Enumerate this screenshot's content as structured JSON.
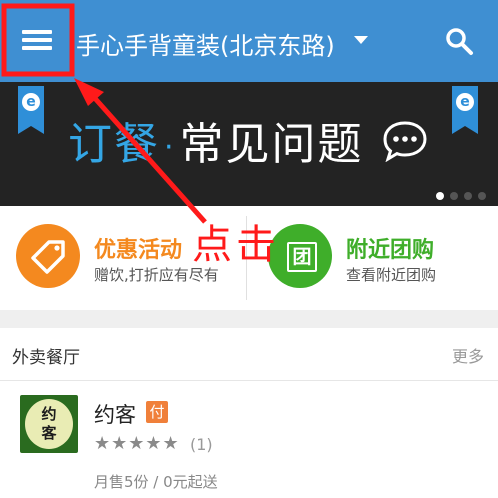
{
  "header": {
    "title": "手心手背童装(北京东路)",
    "menu_icon": "hamburger-menu-icon",
    "dropdown_icon": "caret-down-icon",
    "search_icon": "search-icon",
    "bg_color": "#3f8fd2"
  },
  "banner": {
    "title_part1": "订餐",
    "separator": "·",
    "title_part2": "常见问题",
    "badge_letter": "e",
    "bubble_icon": "chat-bubble-icon",
    "page_count": 4,
    "active_page": 1
  },
  "promos": [
    {
      "title": "优惠活动",
      "subtitle": "赠饮,打折应有尽有",
      "icon": "tag-icon",
      "color": "#f4891f"
    },
    {
      "title": "附近团购",
      "subtitle": "查看附近团购",
      "icon": "group-buy-icon",
      "icon_text": "团",
      "color": "#3fae2a"
    }
  ],
  "section": {
    "title": "外卖餐厅",
    "more_label": "更多"
  },
  "restaurants": [
    {
      "logo_text": "约客",
      "name": "约客",
      "badge": "付",
      "stars": "★★★★★",
      "rating_count": "(1)",
      "sales_info": "月售5份 / 0元起送"
    }
  ],
  "annotation": {
    "label": "点击",
    "color": "#ff1a1a"
  }
}
